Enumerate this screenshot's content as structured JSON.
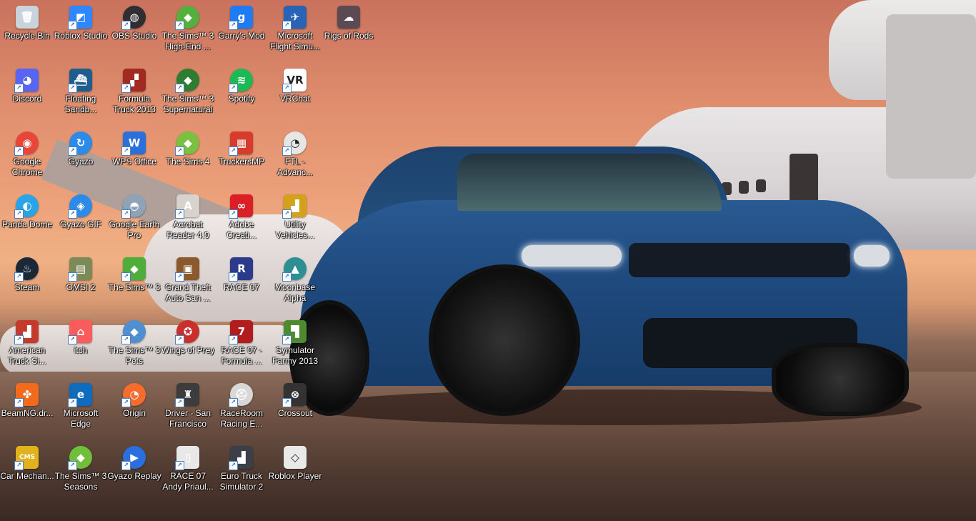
{
  "desktop": {
    "columns": [
      [
        {
          "label": "Recycle Bin",
          "icon": "recycle-bin-icon",
          "color": "#c8d3dc",
          "glyph": "🗑",
          "shortcut": false
        },
        {
          "label": "Discord",
          "icon": "discord-icon",
          "color": "#5865f2",
          "glyph": "◕",
          "shortcut": true
        },
        {
          "label": "Google Chrome",
          "icon": "chrome-icon",
          "color": "#e9463a",
          "glyph": "◉",
          "shortcut": true,
          "round": true
        },
        {
          "label": "Panda Dome",
          "icon": "panda-dome-icon",
          "color": "#2aa4e8",
          "glyph": "◐",
          "shortcut": true,
          "round": true
        },
        {
          "label": "Steam",
          "icon": "steam-icon",
          "color": "#1b2838",
          "glyph": "♨",
          "shortcut": true,
          "round": true
        },
        {
          "label": "American Truck Si...",
          "icon": "american-truck-icon",
          "color": "#c43a2d",
          "glyph": "▟",
          "shortcut": true
        },
        {
          "label": "BeamNG.dr...",
          "icon": "beamng-icon",
          "color": "#f26b1d",
          "glyph": "✤",
          "shortcut": true
        },
        {
          "label": "Car Mechan...",
          "icon": "car-mechanic-icon",
          "color": "#e2b21c",
          "glyph": "CMS",
          "shortcut": true
        }
      ],
      [
        {
          "label": "Roblox Studio",
          "icon": "roblox-studio-icon",
          "color": "#2f87ff",
          "glyph": "◩",
          "shortcut": true
        },
        {
          "label": "Floating Sandb...",
          "icon": "floating-sandbox-icon",
          "color": "#1d5e8e",
          "glyph": "⛴",
          "shortcut": true
        },
        {
          "label": "Gyazo",
          "icon": "gyazo-icon",
          "color": "#2c8ae8",
          "glyph": "↻",
          "shortcut": true,
          "round": true
        },
        {
          "label": "Gyazo GIF",
          "icon": "gyazo-gif-icon",
          "color": "#2c8ae8",
          "glyph": "◈",
          "shortcut": true,
          "round": true
        },
        {
          "label": "OMSI 2",
          "icon": "omsi-icon",
          "color": "#7c8a57",
          "glyph": "▤",
          "shortcut": true
        },
        {
          "label": "itch",
          "icon": "itch-icon",
          "color": "#fa5c5c",
          "glyph": "⌂",
          "shortcut": true
        },
        {
          "label": "Microsoft Edge",
          "icon": "edge-icon",
          "color": "#0f6cbd",
          "glyph": "e",
          "shortcut": true
        },
        {
          "label": "The Sims™ 3 Seasons",
          "icon": "sims-seasons-icon",
          "color": "#6fbf3a",
          "glyph": "◆",
          "shortcut": true,
          "round": true
        }
      ],
      [
        {
          "label": "OBS Studio",
          "icon": "obs-icon",
          "color": "#302e31",
          "glyph": "◍",
          "shortcut": true,
          "round": true
        },
        {
          "label": "Formula Truck 2013",
          "icon": "formula-truck-icon",
          "color": "#a12a22",
          "glyph": "▞",
          "shortcut": true
        },
        {
          "label": "WPS Office",
          "icon": "wps-office-icon",
          "color": "#2b6fdb",
          "glyph": "W",
          "shortcut": true
        },
        {
          "label": "Google Earth Pro",
          "icon": "google-earth-icon",
          "color": "#8fa3b8",
          "glyph": "◓",
          "shortcut": true,
          "round": true
        },
        {
          "label": "The Sims™ 3",
          "icon": "sims3-icon",
          "color": "#4fae3b",
          "glyph": "◆",
          "shortcut": true
        },
        {
          "label": "The Sims™ 3 Pets",
          "icon": "sims-pets-icon",
          "color": "#4f8fcf",
          "glyph": "◆",
          "shortcut": true,
          "round": true
        },
        {
          "label": "Origin",
          "icon": "origin-icon",
          "color": "#f56c2d",
          "glyph": "◔",
          "shortcut": true,
          "round": true
        },
        {
          "label": "Gyazo Replay",
          "icon": "gyazo-replay-icon",
          "color": "#2a6ee0",
          "glyph": "▶",
          "shortcut": true,
          "round": true
        }
      ],
      [
        {
          "label": "The Sims™ 3 High-End ...",
          "icon": "sims-highend-icon",
          "color": "#53b03d",
          "glyph": "◆",
          "shortcut": true,
          "round": true
        },
        {
          "label": "The Sims™ 3 Supernatural",
          "icon": "sims-supernatural-icon",
          "color": "#2e7d32",
          "glyph": "◆",
          "shortcut": true,
          "round": true
        },
        {
          "label": "The Sims 4",
          "icon": "sims4-icon",
          "color": "#7ac142",
          "glyph": "◆",
          "shortcut": true,
          "round": true
        },
        {
          "label": "Acrobat Reader 4.0",
          "icon": "acrobat-icon",
          "color": "#d8d2cc",
          "glyph": "A",
          "shortcut": true
        },
        {
          "label": "Grand Theft Auto San ...",
          "icon": "gta-sa-icon",
          "color": "#8a5a2c",
          "glyph": "▣",
          "shortcut": true
        },
        {
          "label": "Wings of Prey",
          "icon": "wings-of-prey-icon",
          "color": "#c9302c",
          "glyph": "✪",
          "shortcut": true,
          "round": true
        },
        {
          "label": "Driver - San Francisco",
          "icon": "driver-sf-icon",
          "color": "#3c3c3c",
          "glyph": "♜",
          "shortcut": true
        },
        {
          "label": "RACE 07 Andy Priaul...",
          "icon": "race07-document-icon",
          "color": "#e8e8e8",
          "glyph": "▯",
          "shortcut": true
        }
      ],
      [
        {
          "label": "Garry's Mod",
          "icon": "garrys-mod-icon",
          "color": "#1f7bf2",
          "glyph": "g",
          "shortcut": true
        },
        {
          "label": "Spotify",
          "icon": "spotify-icon",
          "color": "#1db954",
          "glyph": "≋",
          "shortcut": true,
          "round": true
        },
        {
          "label": "TruckersMP",
          "icon": "truckersmp-icon",
          "color": "#d63b2b",
          "glyph": "▦",
          "shortcut": true
        },
        {
          "label": "Adobe Creati...",
          "icon": "adobe-cc-icon",
          "color": "#da1f26",
          "glyph": "∞",
          "shortcut": true
        },
        {
          "label": "RACE 07",
          "icon": "race07-icon",
          "color": "#2b3a8a",
          "glyph": "R",
          "shortcut": true
        },
        {
          "label": "RACE 07 - Formula ...",
          "icon": "race07-formula-icon",
          "color": "#b21c1c",
          "glyph": "7",
          "shortcut": true
        },
        {
          "label": "RaceRoom Racing E...",
          "icon": "raceroom-icon",
          "color": "#d8d8d8",
          "glyph": "⛑",
          "shortcut": true,
          "round": true
        },
        {
          "label": "Euro Truck Simulator 2",
          "icon": "euro-truck-icon",
          "color": "#3a3f48",
          "glyph": "▟",
          "shortcut": true
        }
      ],
      [
        {
          "label": "Microsoft Flight Simu...",
          "icon": "flight-sim-icon",
          "color": "#2863b5",
          "glyph": "✈",
          "shortcut": true
        },
        {
          "label": "VRChat",
          "icon": "vrchat-icon",
          "color": "#ffffff",
          "glyph": "VR",
          "shortcut": true,
          "dark": true
        },
        {
          "label": "FTL - Advanc...",
          "icon": "ftl-icon",
          "color": "#e6e6e6",
          "glyph": "◔",
          "shortcut": true,
          "round": true,
          "dark": true
        },
        {
          "label": "Utility Vehicles...",
          "icon": "utility-vehicles-icon",
          "color": "#d4a21a",
          "glyph": "▟",
          "shortcut": true
        },
        {
          "label": "Moonbase Alpha",
          "icon": "moonbase-alpha-icon",
          "color": "#2d8f94",
          "glyph": "▲",
          "shortcut": true,
          "round": true
        },
        {
          "label": "Symulator Farmy 2013",
          "icon": "farm-sim-icon",
          "color": "#4e8a2f",
          "glyph": "▜",
          "shortcut": true
        },
        {
          "label": "Crossout",
          "icon": "crossout-icon",
          "color": "#333333",
          "glyph": "⊗",
          "shortcut": true
        },
        {
          "label": "Roblox Player",
          "icon": "roblox-player-icon",
          "color": "#e9e9e9",
          "glyph": "◇",
          "shortcut": false,
          "dark": true
        }
      ],
      [
        {
          "label": "Rigs of Rods",
          "icon": "rigs-of-rods-icon",
          "color": "#5c4a52",
          "glyph": "☁",
          "shortcut": false
        }
      ]
    ]
  }
}
